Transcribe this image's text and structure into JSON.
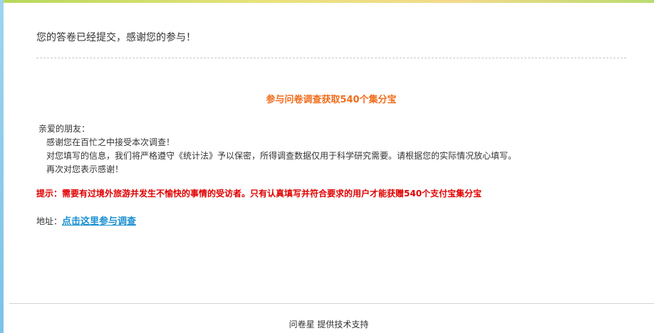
{
  "confirmation": {
    "message": "您的答卷已经提交，感谢您的参与！"
  },
  "survey": {
    "title": "参与问卷调查获取540个集分宝"
  },
  "letter": {
    "greeting": "亲爱的朋友：",
    "lines": [
      "感谢您在百忙之中接受本次调查！",
      "对您填写的信息，我们将严格遵守《统计法》予以保密，所得调查数据仅用于科学研究需要。请根据您的实际情况放心填写。",
      "再次对您表示感谢！"
    ]
  },
  "notice": {
    "text": "提示：需要有过境外旅游并发生不愉快的事情的受访者。只有认真填写并符合要求的用户才能获赠540个支付宝集分宝"
  },
  "address": {
    "label": "地址：",
    "link_text": "点击这里参与调查"
  },
  "footer": {
    "text": "问卷星 提供技术支持"
  },
  "colors": {
    "title_orange": "#f06c1b",
    "notice_red": "#e00000",
    "link_blue": "#1a8fd0"
  }
}
